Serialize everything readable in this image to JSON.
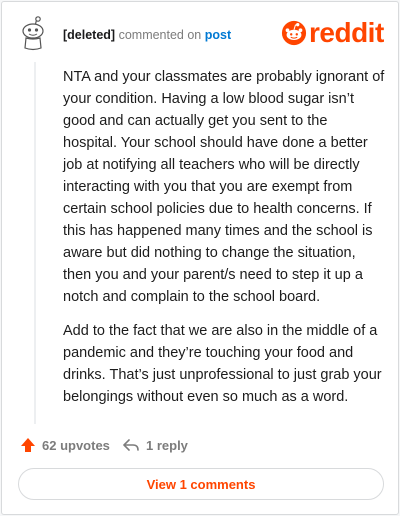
{
  "comment": {
    "author": "[deleted]",
    "action_text": "commented on",
    "target": "post",
    "paragraphs": [
      "NTA and your classmates are probably ignorant of your condition. Having a low blood sugar isn’t good and can actually get you sent to the hospital. Your school should have done a better job at notifying all teachers who will be directly interacting with you that you are exempt from certain school policies due to health concerns. If this has happened many times and the school is aware but did nothing to change the situation, then you and your parent/s need to step it up a notch and complain to the school board.",
      "Add to the fact that we are also in the middle of a pandemic and they’re touching your food and drinks. That’s just unprofessional to just grab your belongings without even so much as a word."
    ],
    "upvotes_label": "62 upvotes",
    "replies_label": "1 reply"
  },
  "brand": {
    "name": "reddit",
    "color": "#ff4500"
  },
  "footer": {
    "view_comments_label": "View 1 comments"
  },
  "icons": {
    "avatar": "snoo-avatar-icon",
    "upvote": "upvote-arrow-icon",
    "reply": "reply-arrow-icon",
    "logo": "reddit-snoo-icon"
  }
}
